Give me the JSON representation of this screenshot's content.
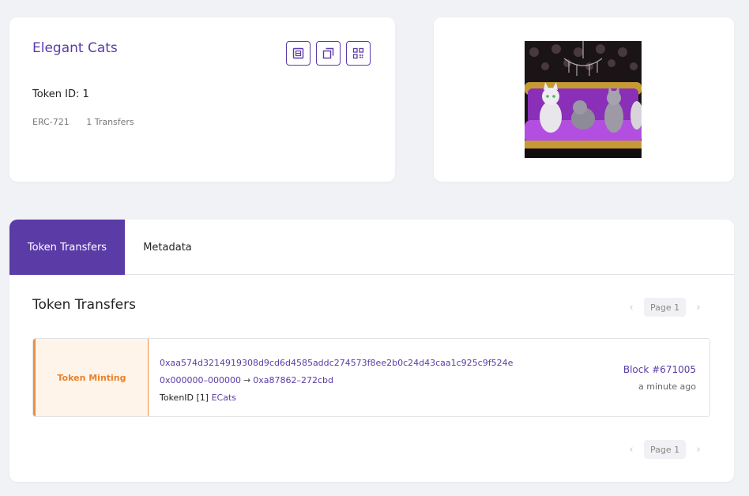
{
  "token": {
    "name": "Elegant Cats",
    "id_label": "Token ID: 1",
    "standard": "ERC-721",
    "transfers_count": "1 Transfers"
  },
  "icons": {
    "details": "details-icon",
    "copy": "copy-icon",
    "qr": "qr-code-icon"
  },
  "image": {
    "alt": "Elegant Cats NFT artwork"
  },
  "tabs": [
    {
      "label": "Token Transfers",
      "active": true
    },
    {
      "label": "Metadata",
      "active": false
    }
  ],
  "transfers": {
    "title": "Token Transfers",
    "pagination": {
      "prev": "‹",
      "page": "Page 1",
      "next": "›"
    },
    "rows": [
      {
        "type": "Token Minting",
        "hash": "0xaa574d3214919308d9cd6d4585addc274573f8ee2b0c24d43caa1c925c9f524e",
        "from": "0x000000–000000",
        "arrow": "→",
        "to": "0xa87862–272cbd",
        "token_prefix": "TokenID [1]",
        "token_link": "ECats",
        "block": "Block #671005",
        "time": "a minute ago"
      }
    ]
  },
  "colors": {
    "accent": "#5b3ba6",
    "minting": "#e9822c",
    "minting_bg": "#fff4ea",
    "page_bg": "#f1f2f6"
  }
}
